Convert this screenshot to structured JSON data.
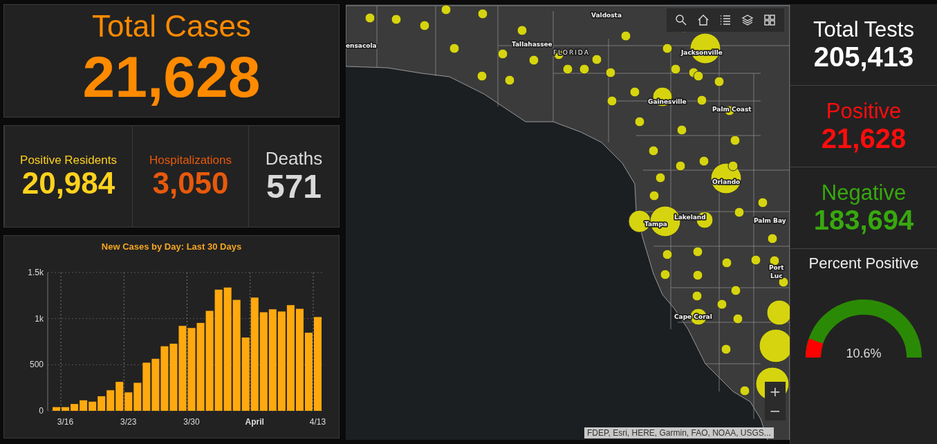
{
  "total_cases": {
    "label": "Total Cases",
    "value": "21,628"
  },
  "stats": [
    {
      "label": "Positive Residents",
      "value": "20,984",
      "color": "#ffd21e"
    },
    {
      "label": "Hospitalizations",
      "value": "3,050",
      "color": "#e8590c"
    },
    {
      "label": "Deaths",
      "value": "571",
      "color": "#d9d9d9"
    }
  ],
  "chart": {
    "chart_data": {
      "type": "bar",
      "title": "New Cases by Day: Last 30 Days",
      "categories": [
        null,
        "3/16",
        null,
        null,
        null,
        null,
        null,
        null,
        "3/23",
        null,
        null,
        null,
        null,
        null,
        null,
        "3/30",
        null,
        null,
        null,
        null,
        null,
        null,
        "April",
        null,
        null,
        null,
        null,
        null,
        null,
        "4/13"
      ],
      "grid": true,
      "series": [
        {
          "color": "#ffa90f",
          "values": [
            40,
            40,
            74,
            114,
            99,
            158,
            223,
            314,
            200,
            304,
            522,
            564,
            700,
            728,
            921,
            898,
            953,
            1084,
            1314,
            1337,
            1203,
            795,
            1228,
            1069,
            1101,
            1077,
            1146,
            1106,
            847,
            1017
          ]
        }
      ],
      "ylim": [
        0,
        1500
      ],
      "yticks": [
        {
          "value": 0,
          "label": "0"
        },
        {
          "value": 500,
          "label": "500"
        },
        {
          "value": 1000,
          "label": "1k"
        },
        {
          "value": 1500,
          "label": "1.5k"
        }
      ]
    }
  },
  "map": {
    "labels": [
      "Valdosta",
      "ensacola",
      "Tallahassee",
      "FLORIDA",
      "Jacksonville",
      "Gainesville",
      "Palm Coast",
      "Orlando",
      "Lakeland",
      "Tampa",
      "Palm Bay",
      "Port",
      "Luc",
      "Cape Coral"
    ],
    "zoom_in": "+",
    "zoom_out": "−",
    "attribution": "FDEP, Esri, HERE, Garmin, FAO, NOAA, USGS..."
  },
  "tests": [
    {
      "label": "Total Tests",
      "value": "205,413",
      "color": "#ffffff"
    },
    {
      "label": "Positive",
      "value": "21,628",
      "color": "#ff0d0d"
    },
    {
      "label": "Negative",
      "value": "183,694",
      "color": "#38a80f"
    }
  ],
  "percent_positive": {
    "label": "Percent Positive",
    "level": 0.106,
    "reading": "10.6%"
  }
}
